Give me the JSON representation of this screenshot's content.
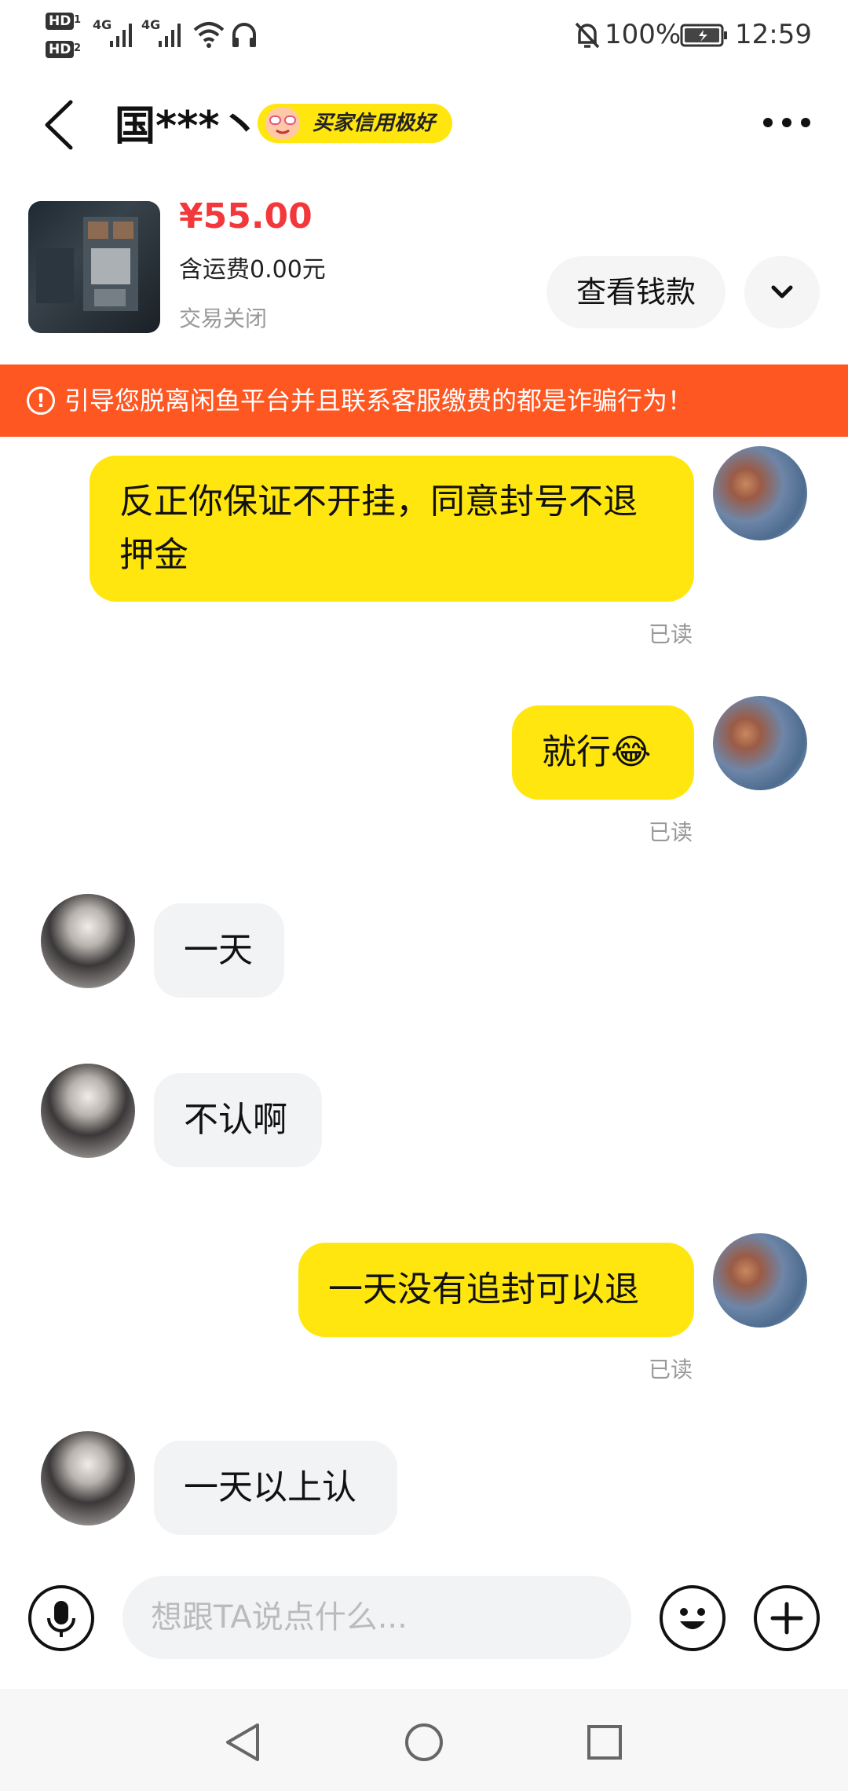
{
  "status_bar": {
    "hd1": "HD",
    "hd2": "HD",
    "sim1": "1",
    "sim2": "2",
    "net1": "4G",
    "net2": "4G",
    "battery": "100%",
    "time": "12:59"
  },
  "header": {
    "contact_name": "国***丶",
    "badge_label": "买家信用极好",
    "back_icon": "chevron-left-icon",
    "more_icon": "more-horizontal-icon"
  },
  "product": {
    "price": "¥55.00",
    "shipping": "含运费0.00元",
    "status": "交易关闭",
    "view_button": "查看钱款"
  },
  "warning": {
    "text": "引导您脱离闲鱼平台并且联系客服缴费的都是诈骗行为！",
    "icon": "!"
  },
  "messages": [
    {
      "from": "me",
      "text": "反正你保证不开挂，同意封号不退押金",
      "read": "已读"
    },
    {
      "from": "me",
      "text": "就行",
      "emoji": "😂",
      "read": "已读"
    },
    {
      "from": "them",
      "text": "一天"
    },
    {
      "from": "them",
      "text": "不认啊"
    },
    {
      "from": "me",
      "text": "一天没有追封可以退",
      "read": "已读"
    },
    {
      "from": "them",
      "text": "一天以上认"
    }
  ],
  "input": {
    "placeholder": "想跟TA说点什么..."
  },
  "colors": {
    "brand_yellow": "#FFE60F",
    "warning_orange": "#FF5722",
    "price_red": "#F2383B"
  }
}
